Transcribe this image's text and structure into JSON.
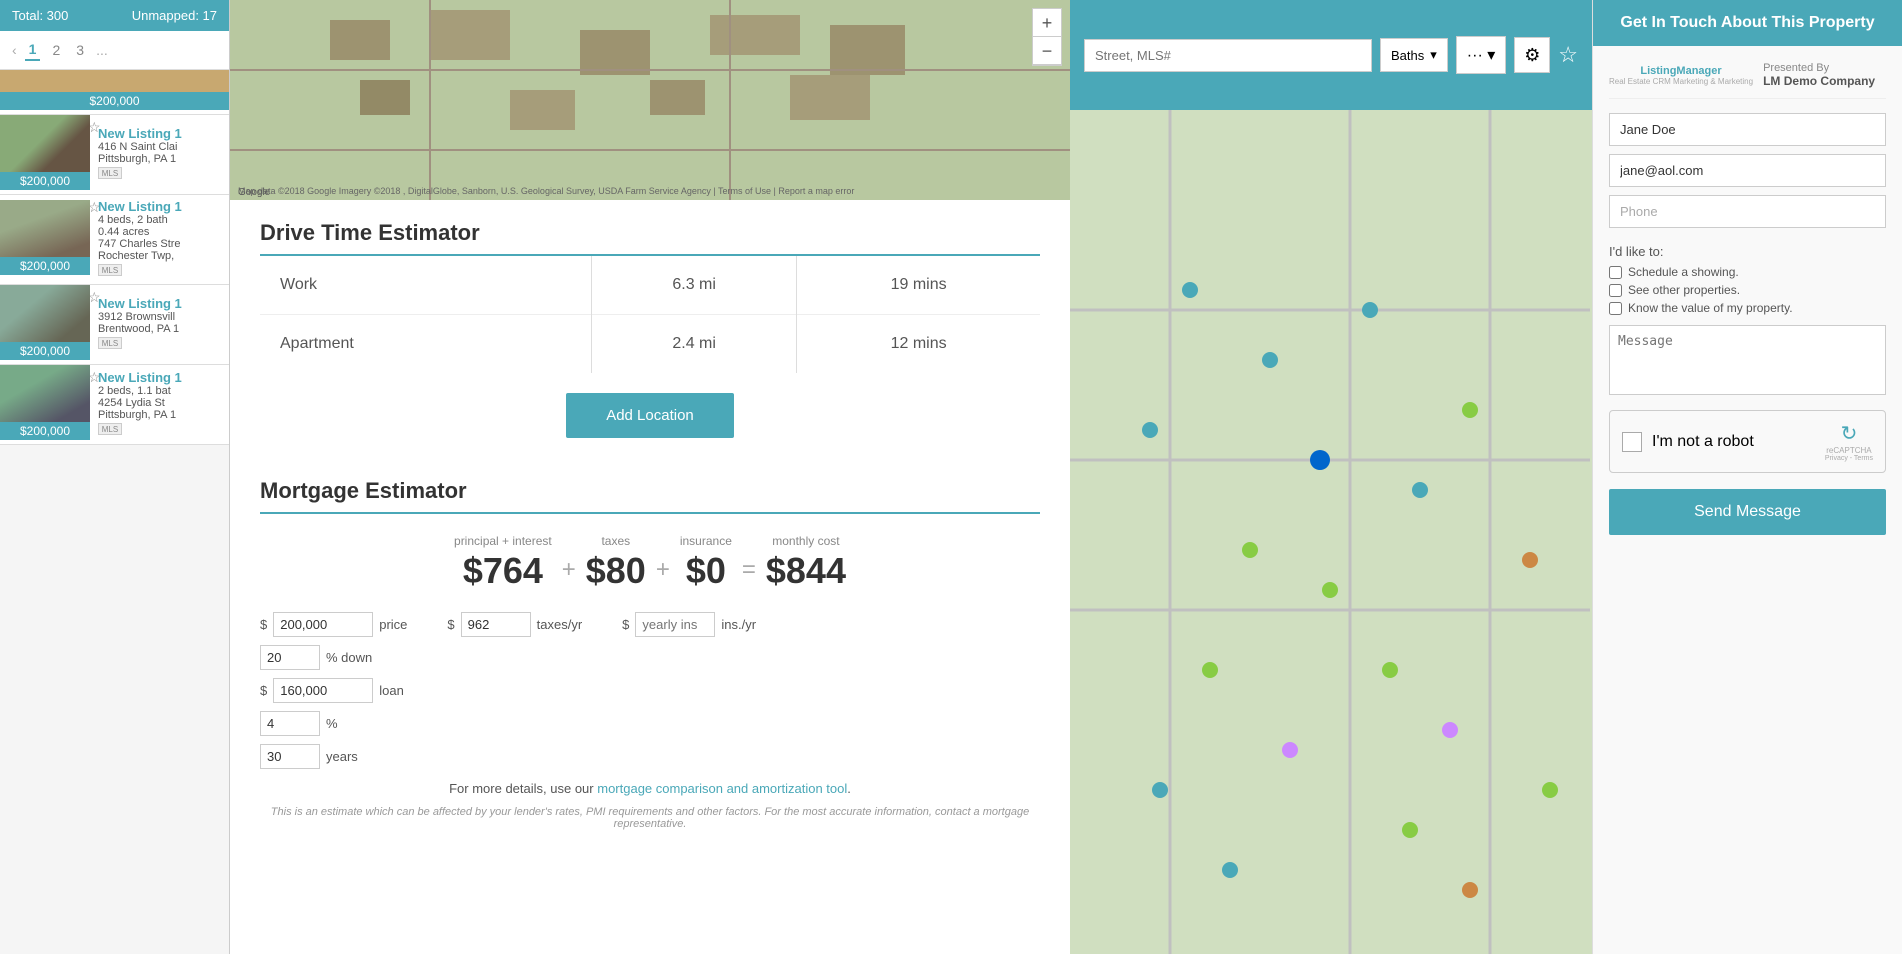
{
  "sidebar": {
    "header": {
      "total_label": "Total: 300",
      "unmapped_label": "Unmapped: 17"
    },
    "pagination": {
      "current": "1",
      "page2": "2",
      "page3": "3",
      "ellipsis": "..."
    },
    "listings": [
      {
        "title": "New Listing 1",
        "address": "416 N Saint Clai",
        "address2": "Pittsburgh, PA 1",
        "price": "$200,000",
        "img_color": "#8a9a7a"
      },
      {
        "title": "New Listing 1",
        "address": "747 Charles Stre",
        "address2": "Rochester Twp,",
        "details": "4 beds, 2 bath",
        "details2": "0.44 acres",
        "price": "$200,000",
        "img_color": "#9a8a7a"
      },
      {
        "title": "New Listing 1",
        "address": "3912 Brownsvill",
        "address2": "Brentwood, PA 1",
        "price": "$200,000",
        "img_color": "#7a8a9a"
      },
      {
        "title": "New Listing 1",
        "address": "4254 Lydia St",
        "address2": "Pittsburgh, PA 1",
        "details": "2 beds, 1.1 bat",
        "price": "$200,000",
        "img_color": "#8a7a6a"
      }
    ]
  },
  "map_section": {
    "google_text": "Google",
    "map_data_text": "Map data ©2018 Google Imagery ©2018 , DigitalGlobe, Sanborn, U.S. Geological Survey, USDA Farm Service Agency | Terms of Use | Report a map error",
    "zoom_in": "+",
    "zoom_out": "−"
  },
  "drive_time": {
    "title": "Drive Time Estimator",
    "locations": [
      {
        "name": "Work",
        "distance": "6.3 mi",
        "time": "19 mins"
      },
      {
        "name": "Apartment",
        "distance": "2.4 mi",
        "time": "12 mins"
      }
    ],
    "add_location_btn": "Add Location"
  },
  "mortgage": {
    "title": "Mortgage Estimator",
    "summary": {
      "principal_label": "principal + interest",
      "principal_value": "$764",
      "taxes_label": "taxes",
      "taxes_value": "$80",
      "insurance_label": "insurance",
      "insurance_value": "$0",
      "monthly_label": "monthly cost",
      "monthly_value": "$844"
    },
    "inputs": {
      "price_prefix": "$",
      "price_value": "200,000",
      "price_label": "price",
      "taxes_prefix": "$",
      "taxes_value": "962",
      "taxes_label": "taxes/yr",
      "ins_prefix": "$",
      "ins_placeholder": "yearly ins",
      "ins_label": "ins./yr",
      "down_value": "20",
      "down_label": "% down",
      "loan_prefix": "$",
      "loan_value": "160,000",
      "loan_label": "loan",
      "rate_value": "4",
      "rate_label": "%",
      "years_value": "30",
      "years_label": "years"
    },
    "footer_text": "For more details, use our ",
    "footer_link": "mortgage comparison and amortization tool",
    "footer_end": ".",
    "disclaimer": "This is an estimate which can be affected by your lender's rates, PMI requirements and other factors. For the most accurate information, contact a mortgage representative."
  },
  "contact_panel": {
    "header": "Get In Touch About This Property",
    "presented_by": "Presented By",
    "company": "LM Demo Company",
    "logo_text": "ListingManager",
    "name_value": "Jane Doe",
    "email_value": "jane@aol.com",
    "phone_placeholder": "Phone",
    "i_like_to": "I'd like to:",
    "checkbox1": "Schedule a showing.",
    "checkbox2": "See other properties.",
    "checkbox3": "Know the value of my property.",
    "message_placeholder": "Message",
    "recaptcha_text": "I'm not a robot",
    "recaptcha_sub": "reCAPTCHA",
    "recaptcha_terms": "Privacy - Terms",
    "send_btn": "Send Message"
  },
  "top_bar": {
    "search_placeholder": "Street, MLS#",
    "baths_label": "Baths",
    "dots": "···",
    "gear": "⚙",
    "star": "☆"
  }
}
